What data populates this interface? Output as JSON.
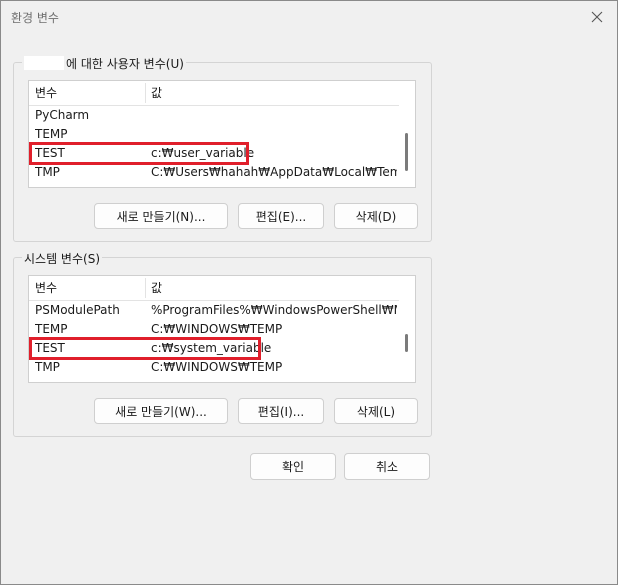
{
  "window": {
    "title": "환경 변수"
  },
  "user_vars": {
    "group_label_suffix": "에 대한 사용자 변수(U)",
    "columns": [
      "변수",
      "값"
    ],
    "rows": [
      {
        "name": "PyCharm",
        "value": ""
      },
      {
        "name": "TEMP",
        "value": ""
      },
      {
        "name": "TEST",
        "value": "c:₩user_variable"
      },
      {
        "name": "TMP",
        "value": "C:₩Users₩hahah₩AppData₩Local₩Temp"
      }
    ],
    "buttons": {
      "new": "새로 만들기(N)...",
      "edit": "편집(E)...",
      "delete": "삭제(D)"
    }
  },
  "system_vars": {
    "group_label": "시스템 변수(S)",
    "columns": [
      "변수",
      "값"
    ],
    "rows": [
      {
        "name": "PSModulePath",
        "value": "%ProgramFiles%₩WindowsPowerShell₩Mo..."
      },
      {
        "name": "TEMP",
        "value": "C:₩WINDOWS₩TEMP"
      },
      {
        "name": "TEST",
        "value": "c:₩system_variable"
      },
      {
        "name": "TMP",
        "value": "C:₩WINDOWS₩TEMP"
      }
    ],
    "buttons": {
      "new": "새로 만들기(W)...",
      "edit": "편집(I)...",
      "delete": "삭제(L)"
    }
  },
  "footer": {
    "ok": "확인",
    "cancel": "취소"
  },
  "icons": {
    "close": "close-icon"
  }
}
